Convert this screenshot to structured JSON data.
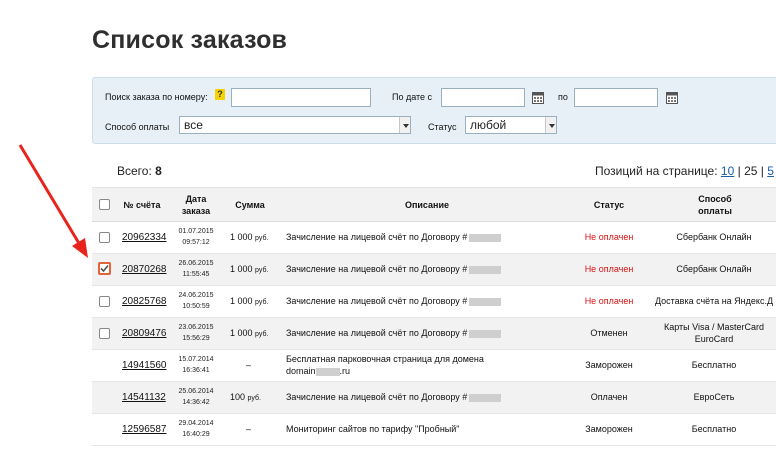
{
  "page": {
    "title": "Список заказов"
  },
  "filters": {
    "search_label": "Поиск заказа по номеру:",
    "help_glyph": "?",
    "date_from_label": "По дате с",
    "date_to_label": "по",
    "payment_label": "Способ оплаты",
    "payment_value": "все",
    "status_label": "Статус",
    "status_value": "любой",
    "search_value": "",
    "date_from_value": "",
    "date_to_value": ""
  },
  "summary": {
    "total_label": "Всего:",
    "total_value": "8",
    "per_page_label": "Позиций на странице:",
    "per_page_options": [
      "10",
      "25",
      "5"
    ],
    "sep": "|"
  },
  "table": {
    "headers": {
      "number": "№ счёта",
      "date": "Дата заказа",
      "sum": "Сумма",
      "description": "Описание",
      "status": "Статус",
      "payment": "Способ оплаты"
    },
    "rows": [
      {
        "checkbox": true,
        "checked": false,
        "number": "20962334",
        "date": "01.07.2015",
        "time": "09:57:12",
        "sum": "1 000",
        "currency": "руб.",
        "description": "Зачисление на лицевой счёт по Договору #",
        "status": "Не оплачен",
        "status_color": "#dd1111",
        "payment": "Сбербанк Онлайн"
      },
      {
        "checkbox": true,
        "checked": true,
        "number": "20870268",
        "date": "26.06.2015",
        "time": "11:55:45",
        "sum": "1 000",
        "currency": "руб.",
        "description": "Зачисление на лицевой счёт по Договору #",
        "status": "Не оплачен",
        "status_color": "#dd1111",
        "payment": "Сбербанк Онлайн"
      },
      {
        "checkbox": true,
        "checked": false,
        "number": "20825768",
        "date": "24.06.2015",
        "time": "10:50:59",
        "sum": "1 000",
        "currency": "руб.",
        "description": "Зачисление на лицевой счёт по Договору #",
        "status": "Не оплачен",
        "status_color": "#dd1111",
        "payment": "Доставка счёта на Яндекс.Д"
      },
      {
        "checkbox": true,
        "checked": false,
        "number": "20809476",
        "date": "23.06.2015",
        "time": "15:56:29",
        "sum": "1 000",
        "currency": "руб.",
        "description": "Зачисление на лицевой счёт по Договору #",
        "status": "Отменен",
        "status_color": "#111111",
        "payment": "Карты Visa / MasterCard",
        "payment_line2": "EuroCard"
      },
      {
        "checkbox": false,
        "checked": false,
        "number": "14941560",
        "date": "15.07.2014",
        "time": "16:36:41",
        "sum": "–",
        "currency": "",
        "description": "Бесплатная парковочная страница для домена",
        "description_line2_start": "domain",
        "description_line2_end": ".ru",
        "status": "Заморожен",
        "status_color": "#111111",
        "payment": "Бесплатно"
      },
      {
        "checkbox": false,
        "checked": false,
        "number": "14541132",
        "date": "25.06.2014",
        "time": "14:36:42",
        "sum": "100",
        "currency": "руб.",
        "description": "Зачисление на лицевой счёт по Договору #",
        "status": "Оплачен",
        "status_color": "#111111",
        "payment": "ЕвроСеть"
      },
      {
        "checkbox": false,
        "checked": false,
        "number": "12596587",
        "date": "29.04.2014",
        "time": "16:40:29",
        "sum": "–",
        "currency": "",
        "description": "Мониторинг сайтов по тарифу \"Пробный\"",
        "status": "Заморожен",
        "status_color": "#111111",
        "payment": "Бесплатно"
      }
    ]
  },
  "colors": {
    "annotation_arrow": "#e8231b",
    "link": "#1a5ea8",
    "unpaid": "#dd1111",
    "checked_border": "#e0643c"
  }
}
